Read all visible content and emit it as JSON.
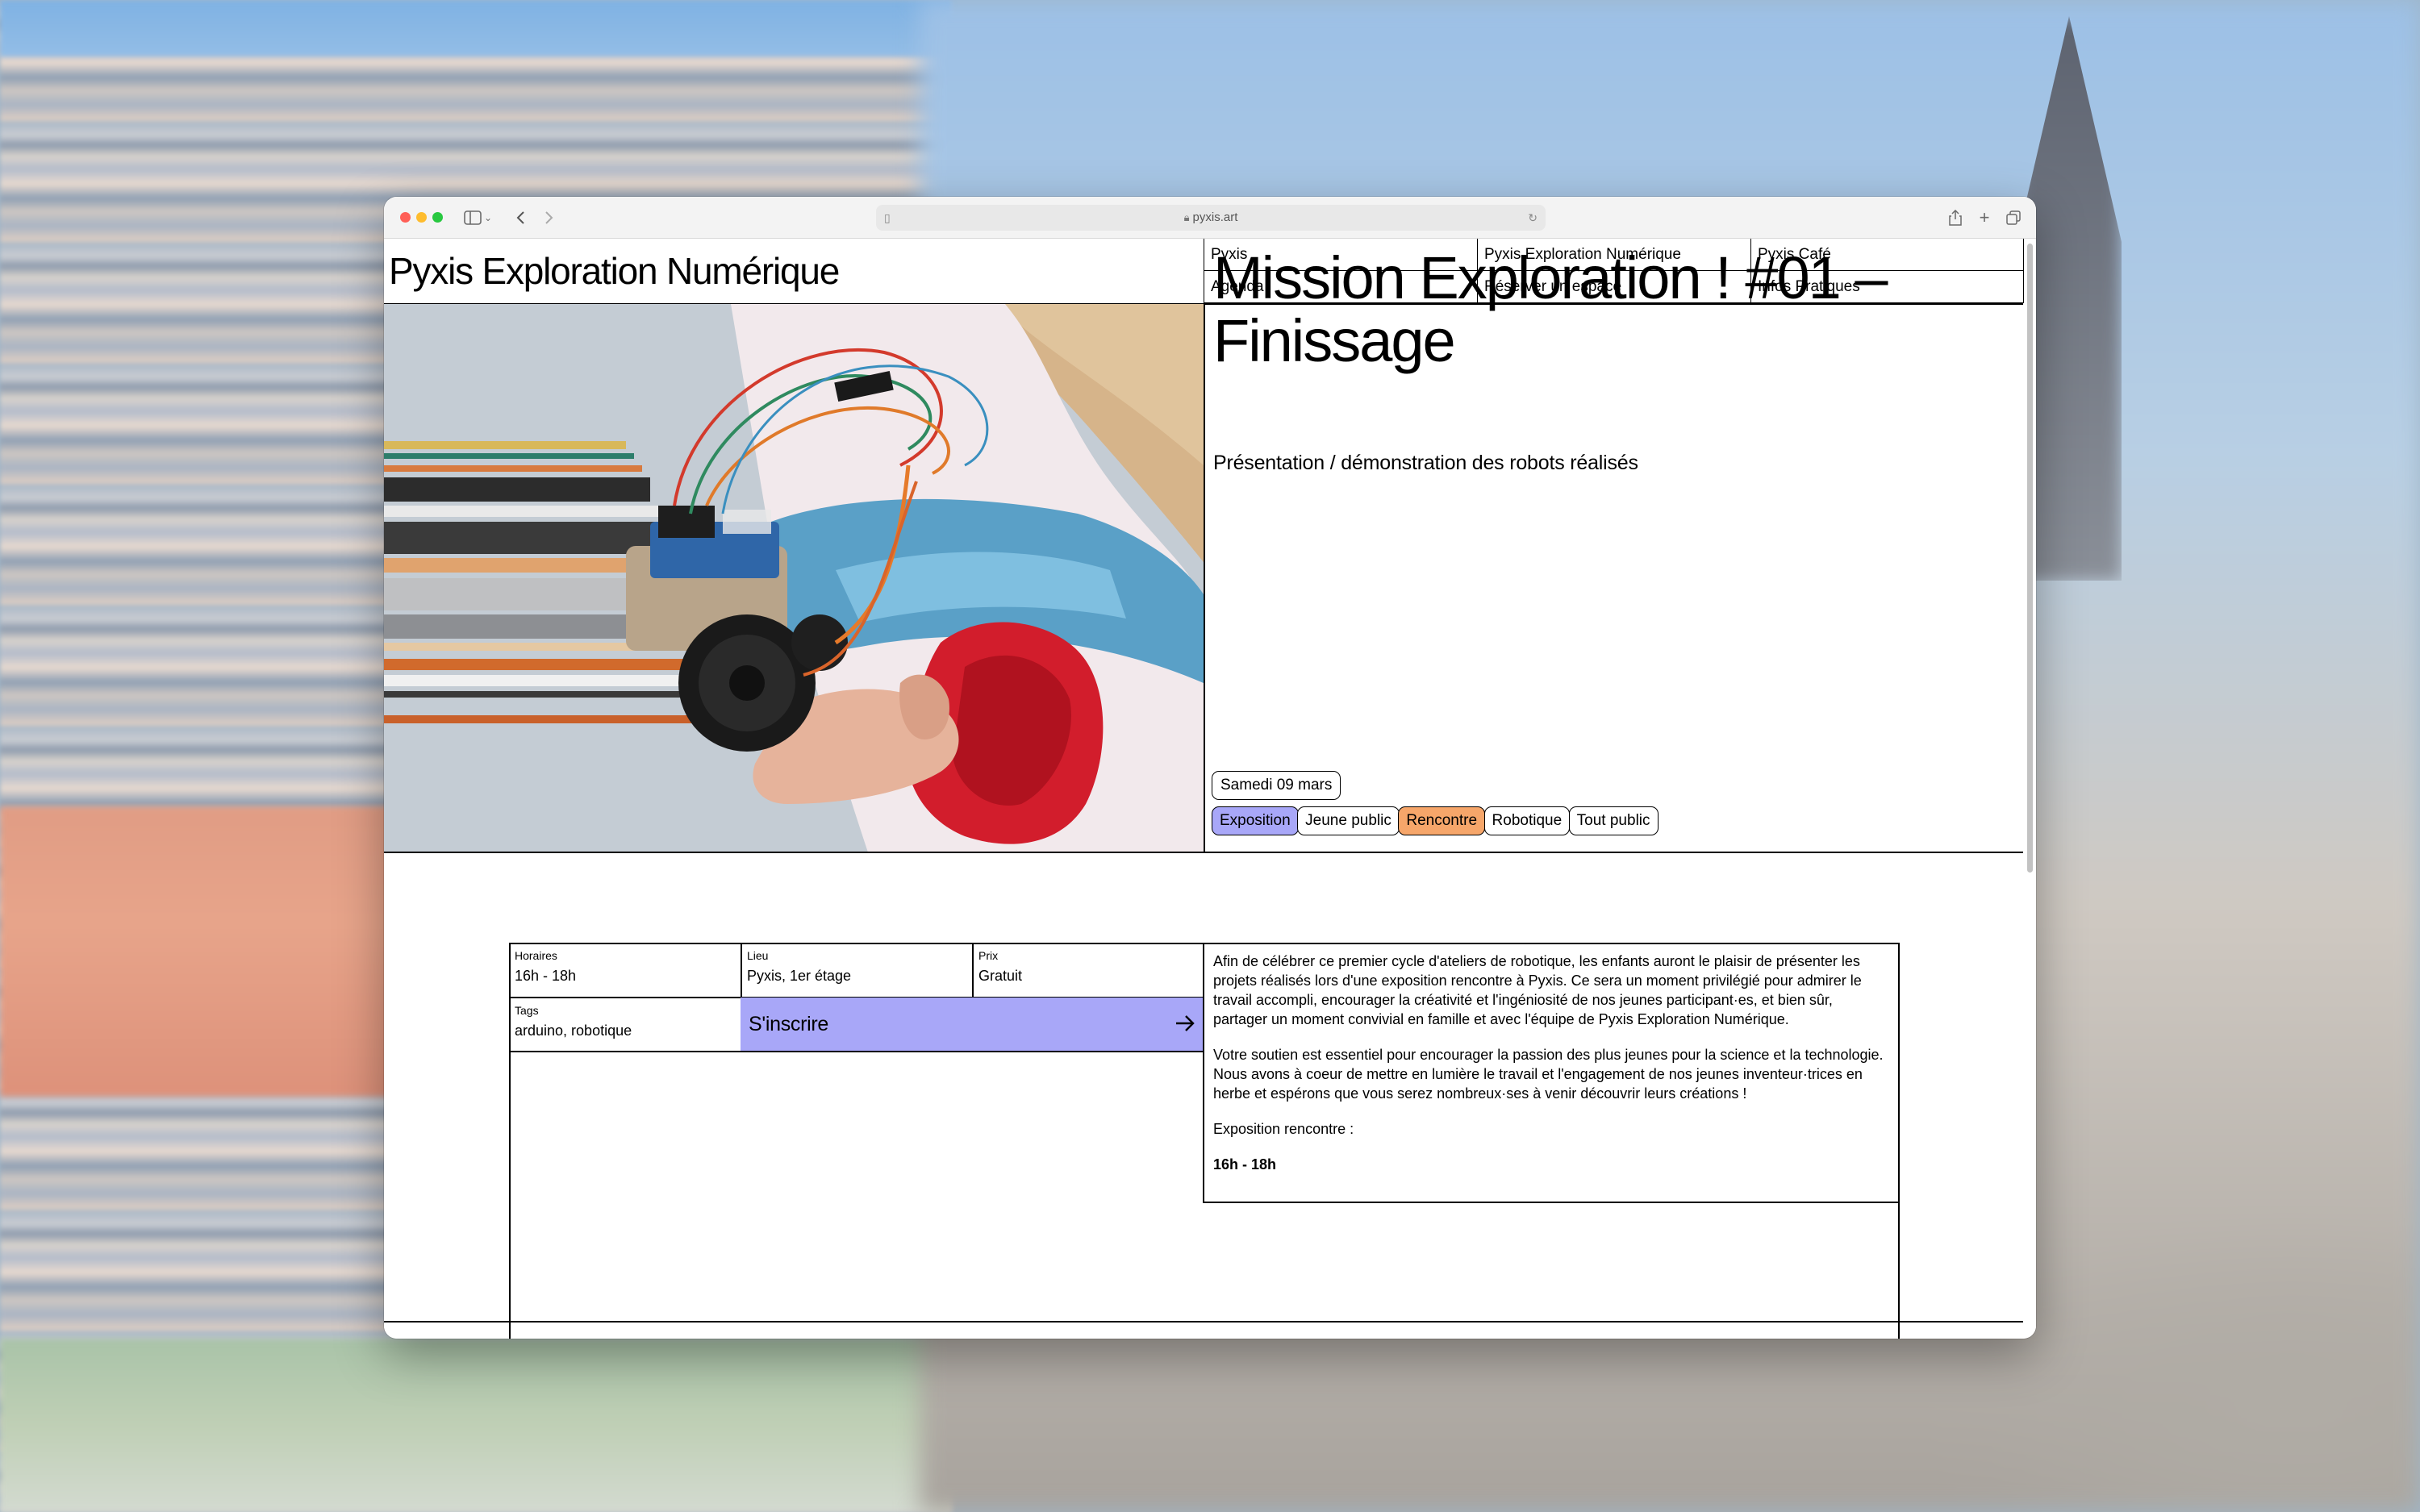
{
  "browser": {
    "url": "pyxis.art"
  },
  "site": {
    "title": "Pyxis Exploration Numérique"
  },
  "nav": {
    "row1": [
      "Pyxis",
      "Pyxis Exploration Numérique",
      "Pyxis Café"
    ],
    "row2": [
      "Agenda",
      "Réserver un espace",
      "Infos Pratiques"
    ]
  },
  "event": {
    "title_line1": "Mission Exploration ! #01 –",
    "title_line2": "Finissage",
    "subtitle": "Présentation / démonstration des robots réalisés",
    "date": "Samedi 09 mars",
    "tags": [
      "Exposition",
      "Jeune public",
      "Rencontre",
      "Robotique",
      "Tout public"
    ]
  },
  "info": {
    "horaires_label": "Horaires",
    "horaires_value": "16h - 18h",
    "lieu_label": "Lieu",
    "lieu_value": "Pyxis, 1er étage",
    "prix_label": "Prix",
    "prix_value": "Gratuit",
    "tags_label": "Tags",
    "tags_value": "arduino, robotique",
    "register_label": "S'inscrire"
  },
  "description": {
    "p1": "Afin de célébrer ce premier cycle d'ateliers de robotique, les enfants auront le plaisir de présenter les projets réalisés lors d'une exposition rencontre à Pyxis. Ce sera un moment privilégié pour admirer le travail accompli, encourager la créativité et l'ingéniosité de nos jeunes participant·es, et bien sûr, partager un moment convivial en famille et avec l'équipe de Pyxis Exploration Numérique.",
    "p2": "Votre soutien est essentiel pour encourager la passion des plus jeunes pour la science et la technologie. Nous avons à coeur de mettre en lumière le travail et l'engagement de nos jeunes inventeur·trices en herbe et espérons que vous serez nombreux·ses à venir découvrir leurs créations !",
    "p3": "Exposition rencontre :",
    "p4": "16h - 18h"
  },
  "colors": {
    "tag_blue": "#a8a7f8",
    "tag_orange": "#f6a66a"
  }
}
